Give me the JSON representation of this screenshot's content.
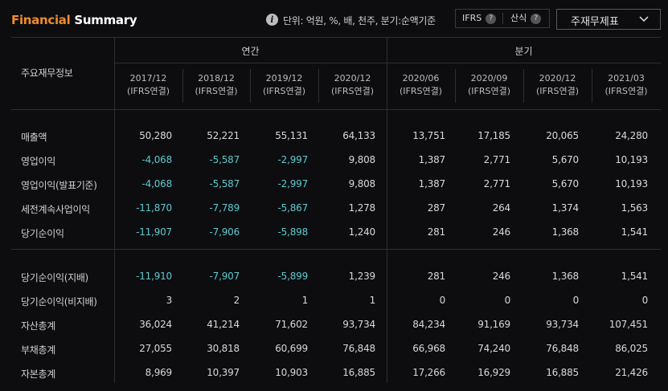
{
  "header": {
    "title_accent": "Financial",
    "title_rest": " Summary",
    "info_icon": "info-icon",
    "unit_text": "단위: 억원, %, 배, 천주, 분기:순액기준",
    "toggle": [
      {
        "label": "IFRS",
        "help": "?"
      },
      {
        "label": "산식",
        "help": "?"
      }
    ],
    "select": {
      "value": "주재무제표",
      "icon": "chevron-down-icon"
    }
  },
  "colors": {
    "accent": "#f08c2a",
    "negative": "#5cc9cf",
    "background": "#0d0d0f"
  },
  "table": {
    "corner_label": "주요재무정보",
    "groups": [
      "연간",
      "분기"
    ],
    "columns": [
      {
        "period": "2017/12",
        "basis": "(IFRS연결)"
      },
      {
        "period": "2018/12",
        "basis": "(IFRS연결)"
      },
      {
        "period": "2019/12",
        "basis": "(IFRS연결)"
      },
      {
        "period": "2020/12",
        "basis": "(IFRS연결)"
      },
      {
        "period": "2020/06",
        "basis": "(IFRS연결)"
      },
      {
        "period": "2020/09",
        "basis": "(IFRS연결)"
      },
      {
        "period": "2020/12",
        "basis": "(IFRS연결)"
      },
      {
        "period": "2021/03",
        "basis": "(IFRS연결)"
      }
    ],
    "rows": [
      {
        "label": "매출액",
        "values": [
          "50,280",
          "52,221",
          "55,131",
          "64,133",
          "13,751",
          "17,185",
          "20,065",
          "24,280"
        ]
      },
      {
        "label": "영업이익",
        "values": [
          "-4,068",
          "-5,587",
          "-2,997",
          "9,808",
          "1,387",
          "2,771",
          "5,670",
          "10,193"
        ]
      },
      {
        "label": "영업이익(발표기준)",
        "values": [
          "-4,068",
          "-5,587",
          "-2,997",
          "9,808",
          "1,387",
          "2,771",
          "5,670",
          "10,193"
        ]
      },
      {
        "label": "세전계속사업이익",
        "values": [
          "-11,870",
          "-7,789",
          "-5,867",
          "1,278",
          "287",
          "264",
          "1,374",
          "1,563"
        ]
      },
      {
        "label": "당기순이익",
        "values": [
          "-11,907",
          "-7,906",
          "-5,898",
          "1,240",
          "281",
          "246",
          "1,368",
          "1,541"
        ]
      },
      {
        "label": "당기순이익(지배)",
        "values": [
          "-11,910",
          "-7,907",
          "-5,899",
          "1,239",
          "281",
          "246",
          "1,368",
          "1,541"
        ]
      },
      {
        "label": "당기순이익(비지배)",
        "values": [
          "3",
          "2",
          "1",
          "1",
          "0",
          "0",
          "0",
          "0"
        ]
      },
      {
        "label": "자산총계",
        "values": [
          "36,024",
          "41,214",
          "71,602",
          "93,734",
          "84,234",
          "91,169",
          "93,734",
          "107,451"
        ]
      },
      {
        "label": "부채총계",
        "values": [
          "27,055",
          "30,818",
          "60,699",
          "76,848",
          "66,968",
          "74,240",
          "76,848",
          "86,025"
        ]
      },
      {
        "label": "자본총계",
        "values": [
          "8,969",
          "10,397",
          "10,903",
          "16,885",
          "17,266",
          "16,929",
          "16,885",
          "21,426"
        ]
      }
    ]
  }
}
